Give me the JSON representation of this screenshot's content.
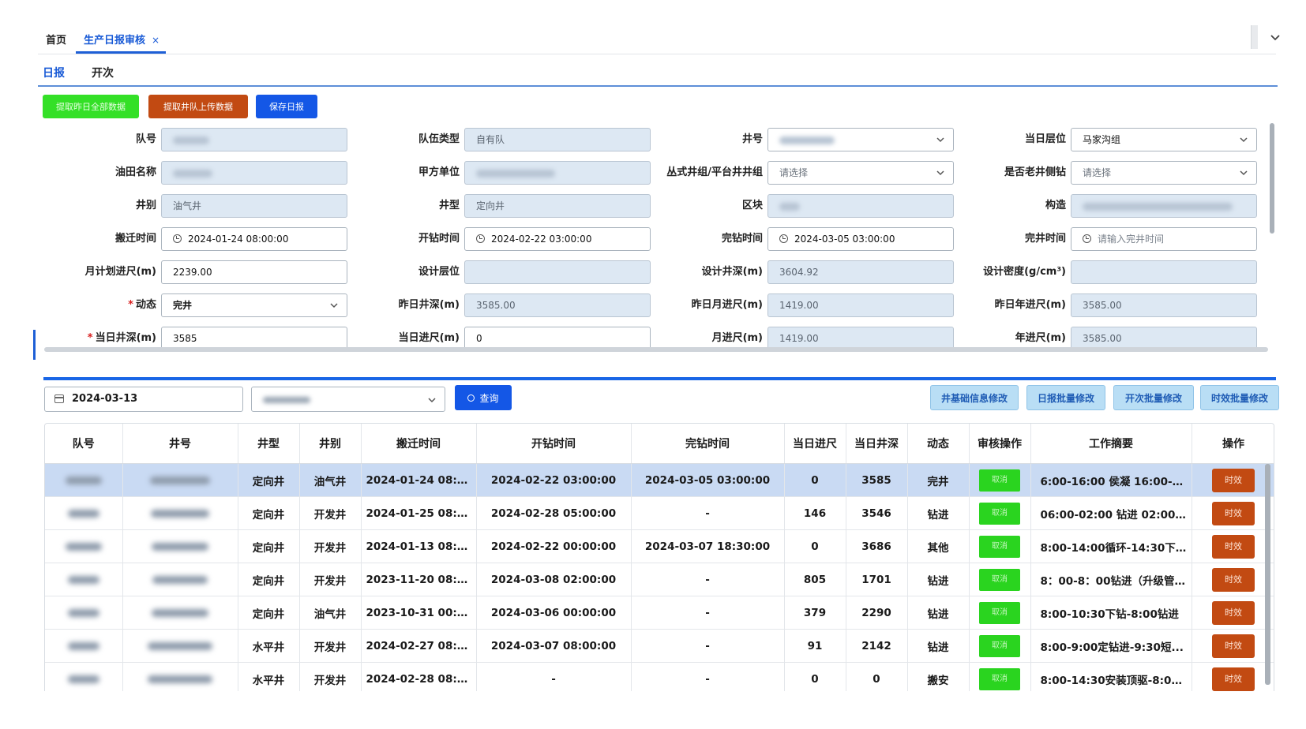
{
  "top_tabs": [
    {
      "label": "首页"
    },
    {
      "label": "生产日报审核",
      "close": "×"
    }
  ],
  "sub_tabs": [
    "日报",
    "开次"
  ],
  "actions": {
    "extract_prev_day": "提取昨日全部数据",
    "extract_team_upload": "提取井队上传数据",
    "save_report": "保存日报"
  },
  "form": {
    "team_no": {
      "label": "队号"
    },
    "team_type": {
      "label": "队伍类型",
      "value": "自有队"
    },
    "well_no": {
      "label": "井号"
    },
    "layer_today": {
      "label": "当日层位",
      "value": "马家沟组"
    },
    "oilfield": {
      "label": "油田名称"
    },
    "party_a": {
      "label": "甲方单位"
    },
    "cluster_group": {
      "label": "丛式井组/平台井井组",
      "value": "请选择"
    },
    "old_well_side": {
      "label": "是否老井侧钻",
      "value": "请选择"
    },
    "well_kind": {
      "label": "井别",
      "value": "油气井"
    },
    "well_type": {
      "label": "井型",
      "value": "定向井"
    },
    "block": {
      "label": "区块"
    },
    "structure": {
      "label": "构造"
    },
    "move_time": {
      "label": "搬迁时间",
      "value": "2024-01-24 08:00:00"
    },
    "spud_time": {
      "label": "开钻时间",
      "value": "2024-02-22 03:00:00"
    },
    "finish_drill_time": {
      "label": "完钻时间",
      "value": "2024-03-05 03:00:00"
    },
    "completion_time": {
      "label": "完井时间",
      "placeholder": "请输入完井时间"
    },
    "month_plan": {
      "label": "月计划进尺(m)",
      "value": "2239.00"
    },
    "design_layer": {
      "label": "设计层位",
      "value": ""
    },
    "design_depth": {
      "label": "设计井深(m)",
      "value": "3604.92"
    },
    "design_density": {
      "label": "设计密度(g/cm³)",
      "value": ""
    },
    "status": {
      "label": "动态",
      "value": "完井"
    },
    "prev_depth": {
      "label": "昨日井深(m)",
      "value": "3585.00"
    },
    "prev_month": {
      "label": "昨日月进尺(m)",
      "value": "1419.00"
    },
    "prev_year": {
      "label": "昨日年进尺(m)",
      "value": "3585.00"
    },
    "today_depth": {
      "label": "当日井深(m)",
      "value": "3585"
    },
    "today_footage": {
      "label": "当日进尺(m)",
      "value": "0"
    },
    "month_footage": {
      "label": "月进尺(m)",
      "value": "1419.00"
    },
    "year_footage": {
      "label": "年进尺(m)",
      "value": "3585.00"
    }
  },
  "filter": {
    "date": "2024-03-13",
    "query": "查询",
    "buttons": [
      "井基础信息修改",
      "日报批量修改",
      "开次批量修改",
      "时效批量修改"
    ]
  },
  "table": {
    "columns": [
      "队号",
      "井号",
      "井型",
      "井别",
      "搬迁时间",
      "开钻时间",
      "完钻时间",
      "当日进尺",
      "当日井深",
      "动态",
      "审核操作",
      "工作摘要",
      "操作"
    ],
    "cancel_label": "取消",
    "op_label": "时效",
    "rows": [
      {
        "type": "定向井",
        "kind": "油气井",
        "move": "2024-01-24 08:0...",
        "spud": "2024-02-22 03:00:00",
        "finish": "2024-03-05 03:00:00",
        "footage": "0",
        "depth": "3585",
        "status": "完井",
        "summary": "6:00-16:00 侯凝 16:00-1..."
      },
      {
        "type": "定向井",
        "kind": "开发井",
        "move": "2024-01-25 08:0...",
        "spud": "2024-02-28 05:00:00",
        "finish": "-",
        "footage": "146",
        "depth": "3546",
        "status": "钻进",
        "summary": "06:00-02:00 钻进 02:00-..."
      },
      {
        "type": "定向井",
        "kind": "开发井",
        "move": "2024-01-13 08:0...",
        "spud": "2024-02-22 00:00:00",
        "finish": "2024-03-07 18:30:00",
        "footage": "0",
        "depth": "3686",
        "status": "其他",
        "summary": "8:00-14:00循环-14:30下..."
      },
      {
        "type": "定向井",
        "kind": "开发井",
        "move": "2023-11-20 08:0...",
        "spud": "2024-03-08 02:00:00",
        "finish": "-",
        "footage": "805",
        "depth": "1701",
        "status": "钻进",
        "summary": "8：00-8：00钻进（升级管..."
      },
      {
        "type": "定向井",
        "kind": "油气井",
        "move": "2023-10-31 00:0...",
        "spud": "2024-03-06 00:00:00",
        "finish": "-",
        "footage": "379",
        "depth": "2290",
        "status": "钻进",
        "summary": "8:00-10:30下钻-8:00钻进"
      },
      {
        "type": "水平井",
        "kind": "开发井",
        "move": "2024-02-27 08:0...",
        "spud": "2024-03-07 08:00:00",
        "finish": "-",
        "footage": "91",
        "depth": "2142",
        "status": "钻进",
        "summary": "8:00-9:00定钻进-9:30短..."
      },
      {
        "type": "水平井",
        "kind": "开发井",
        "move": "2024-02-28 08:0...",
        "spud": "-",
        "finish": "-",
        "footage": "0",
        "depth": "0",
        "status": "搬安",
        "summary": "8:00-14:30安装顶驱-8:00..."
      }
    ]
  }
}
